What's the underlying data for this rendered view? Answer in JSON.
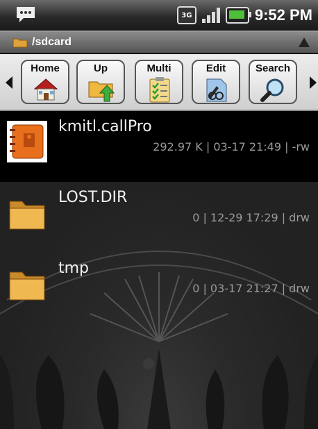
{
  "status_bar": {
    "time": "9:52 PM",
    "network": "3G",
    "icons": [
      "chat-icon",
      "3g-icon",
      "signal-icon",
      "battery-icon"
    ]
  },
  "path_bar": {
    "path": "/sdcard",
    "icons": [
      "folder-icon",
      "up-arrow-icon"
    ]
  },
  "toolbar": {
    "buttons": [
      {
        "label": "Home",
        "icon": "home-icon"
      },
      {
        "label": "Up",
        "icon": "folder-up-icon"
      },
      {
        "label": "Multi",
        "icon": "checklist-icon"
      },
      {
        "label": "Edit",
        "icon": "edit-icon"
      },
      {
        "label": "Search",
        "icon": "magnifier-icon"
      }
    ]
  },
  "files": [
    {
      "name": "kmitl.callPro",
      "meta": "292.97 K | 03-17 21:49 | -rw",
      "icon": "contacts-app-icon",
      "selected": true
    },
    {
      "name": "LOST.DIR",
      "meta": "0 | 12-29 17:29 | drw",
      "icon": "folder-icon",
      "selected": false
    },
    {
      "name": "tmp",
      "meta": "0 | 03-17 21:27 | drw",
      "icon": "folder-icon",
      "selected": false
    }
  ],
  "colors": {
    "battery_green": "#4fbf3a",
    "folder_orange": "#e0a23a",
    "app_icon_orange": "#e8701c"
  }
}
